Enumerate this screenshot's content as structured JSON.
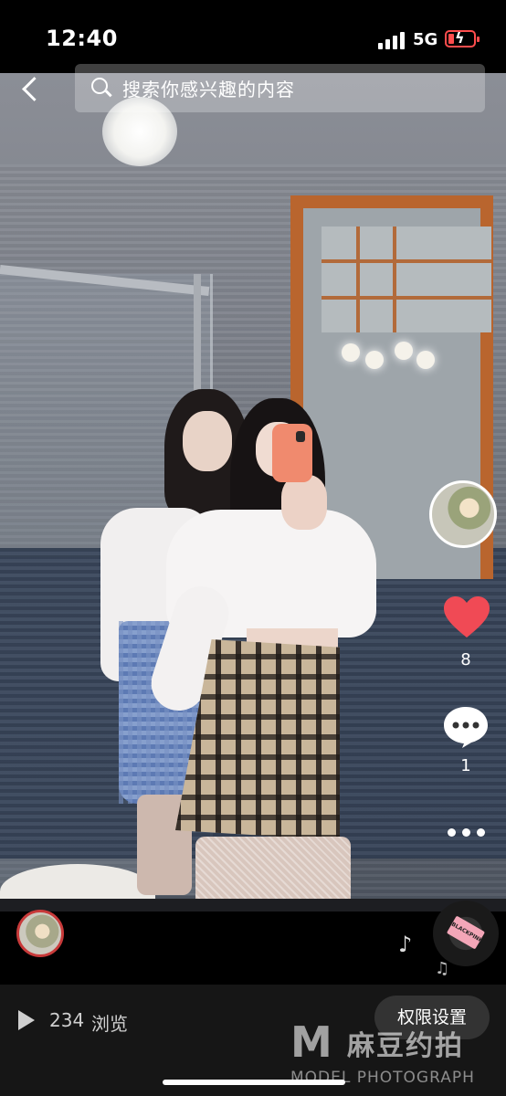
{
  "status_bar": {
    "time": "12:40",
    "network": "5G"
  },
  "search": {
    "placeholder": "搜索你感兴趣的内容"
  },
  "actions": {
    "likes": "8",
    "comments": "1"
  },
  "music": {
    "disc_label": "BLACKPINK"
  },
  "footer": {
    "views_count": "234",
    "views_label": "浏览",
    "permission_label": "权限设置"
  },
  "watermark": {
    "logo": "M",
    "name": "麻豆约拍",
    "subtitle": "MODEL PHOTOGRAPH"
  },
  "colors": {
    "like": "#f04a55",
    "avatar_ring": "#c83a3a",
    "battery": "#ff4d4d"
  }
}
